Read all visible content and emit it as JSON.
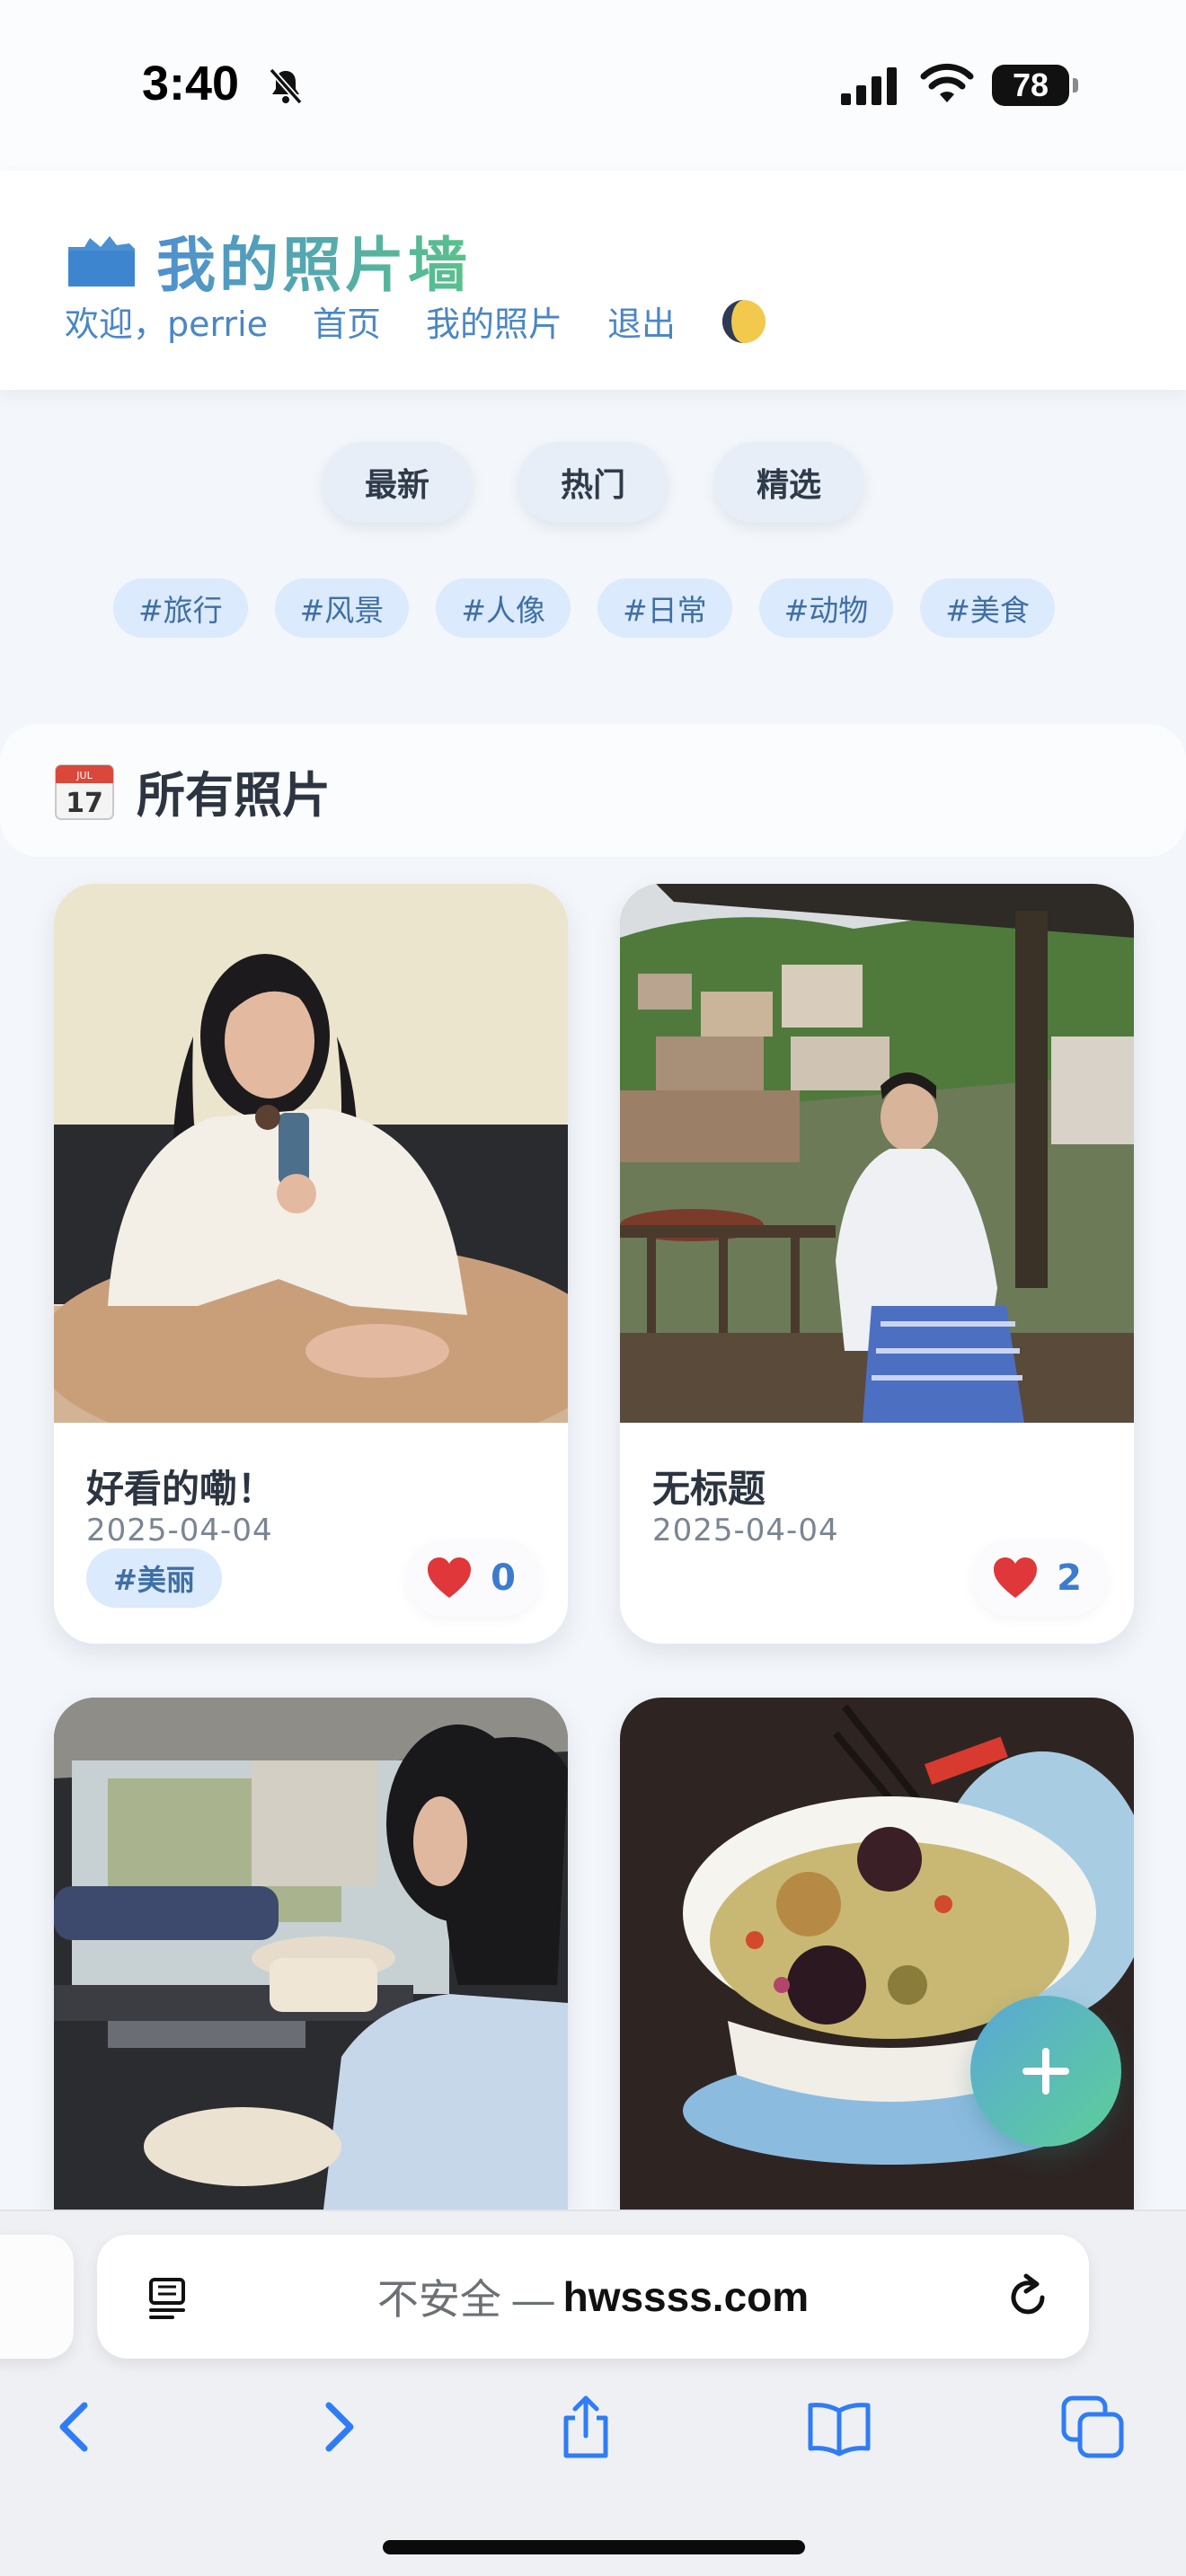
{
  "status_bar": {
    "time": "3:40",
    "battery": "78",
    "icons": [
      "bell-slash-icon",
      "cellular-signal-icon",
      "wifi-icon",
      "battery-icon"
    ]
  },
  "header": {
    "logo_icon": "camera-icon",
    "title": "我的照片墙",
    "welcome": "欢迎，perrie",
    "nav": {
      "home": "首页",
      "my_photos": "我的照片",
      "logout": "退出"
    },
    "theme_icon": "moon-icon"
  },
  "sort_tabs": [
    "最新",
    "热门",
    "精选"
  ],
  "tags": [
    "#旅行",
    "#风景",
    "#人像",
    "#日常",
    "#动物",
    "#美食"
  ],
  "section": {
    "icon": "calendar-icon",
    "title": "所有照片"
  },
  "photos": [
    {
      "title": "好看的嘞！",
      "date": "2025-04-04",
      "tag": "#美丽",
      "likes": "0"
    },
    {
      "title": "无标题",
      "date": "2025-04-04",
      "likes": "2"
    },
    {
      "title": "",
      "date": ""
    },
    {
      "title": "",
      "date": ""
    }
  ],
  "fab": {
    "icon": "plus-icon"
  },
  "browser": {
    "url_prefix": "不安全 —",
    "domain": "hwssss.com",
    "toolbar_icons": [
      "back-icon",
      "forward-icon",
      "share-icon",
      "bookmarks-icon",
      "tabs-icon"
    ]
  },
  "colors": {
    "accent_blue": "#4a86c6",
    "title_gradient_start": "#4f8fd0",
    "title_gradient_end": "#59c28a",
    "chip_bg": "#dbeafc",
    "like_count": "#3b7bd0",
    "page_bg": "#f3f6fa"
  }
}
